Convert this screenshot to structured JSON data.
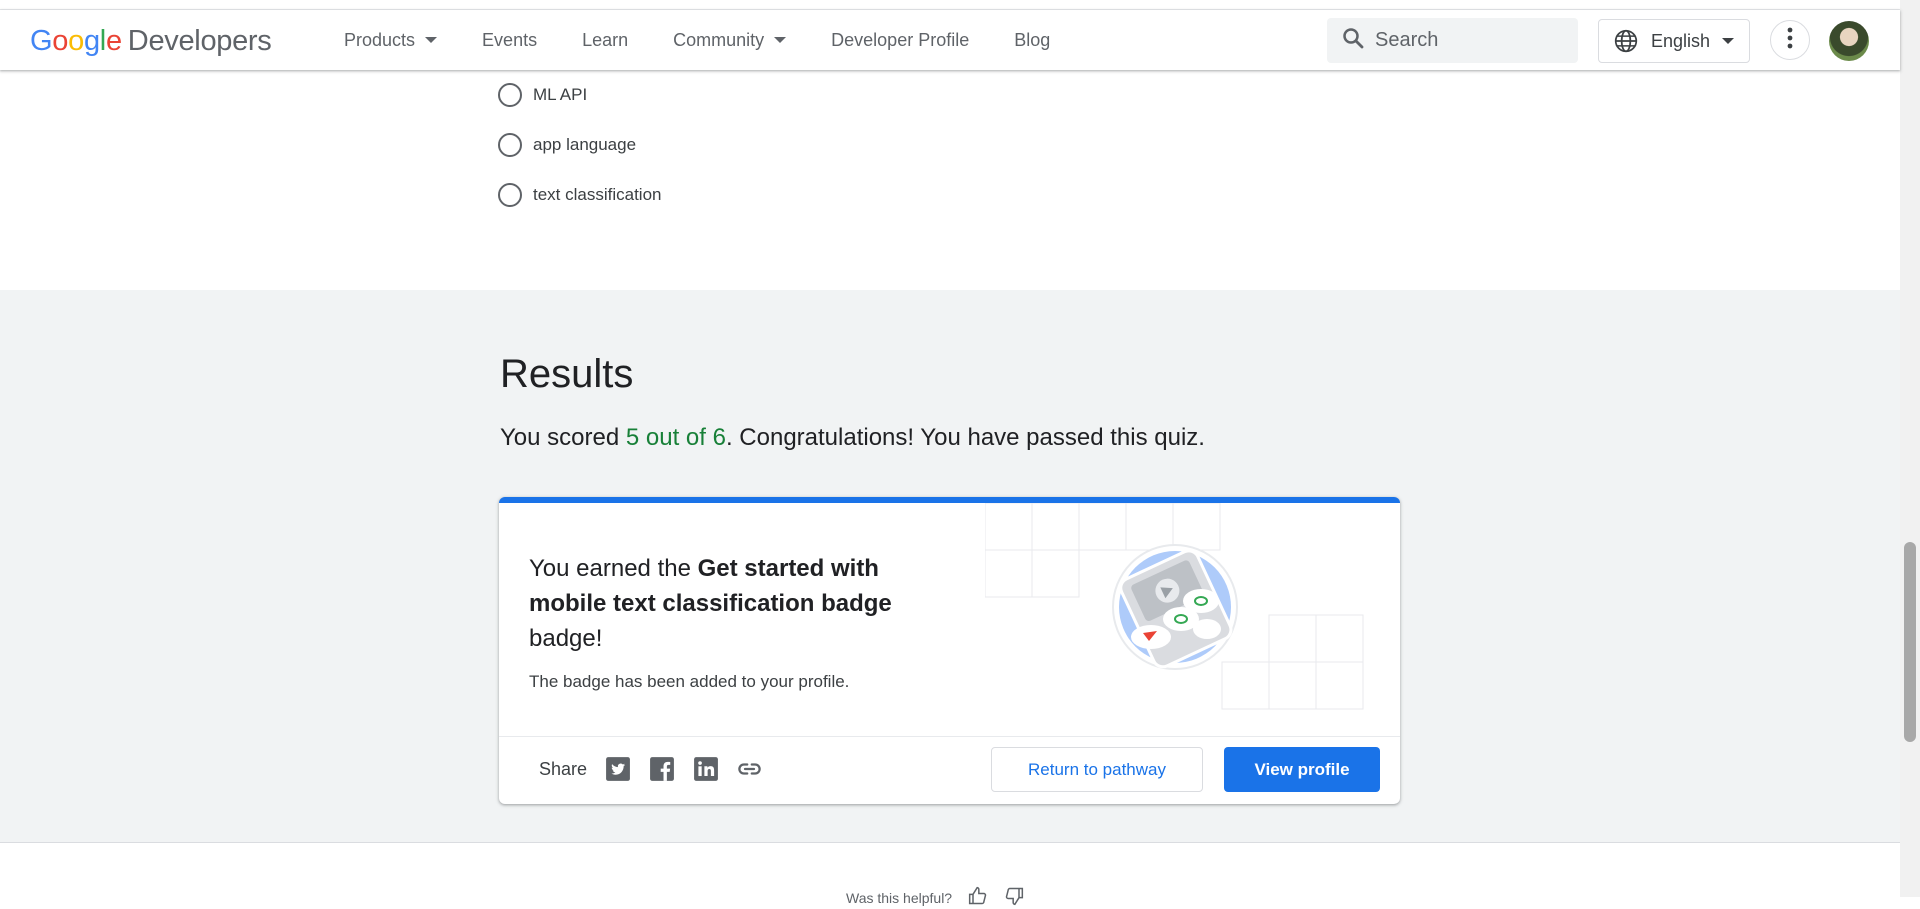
{
  "header": {
    "logo": {
      "google": [
        "G",
        "o",
        "o",
        "g",
        "l",
        "e"
      ],
      "developers": "Developers"
    },
    "nav": [
      {
        "label": "Products",
        "dropdown": true
      },
      {
        "label": "Events",
        "dropdown": false
      },
      {
        "label": "Learn",
        "dropdown": false
      },
      {
        "label": "Community",
        "dropdown": true
      },
      {
        "label": "Developer Profile",
        "dropdown": false
      },
      {
        "label": "Blog",
        "dropdown": false
      }
    ],
    "search_placeholder": "Search",
    "language": "English"
  },
  "quiz": {
    "options": [
      "ML API",
      "app language",
      "text classification"
    ]
  },
  "results": {
    "title": "Results",
    "score_prefix": "You scored ",
    "score_points": "5 out of 6",
    "score_suffix": ". Congratulations! You have passed this quiz.",
    "badge": {
      "earned_prefix": "You earned the ",
      "badge_name": "Get started with mobile text classification badge",
      "earned_suffix": " badge!",
      "added_note": "The badge has been added to your profile."
    },
    "share_label": "Share",
    "share_icons": [
      "twitter-icon",
      "facebook-icon",
      "linkedin-icon",
      "link-icon"
    ],
    "return_button": "Return to pathway",
    "view_profile_button": "View profile"
  },
  "feedback": {
    "question": "Was this helpful?"
  },
  "colors": {
    "accent": "#1a73e8",
    "score": "#188038",
    "section_bg": "#f1f3f4"
  }
}
